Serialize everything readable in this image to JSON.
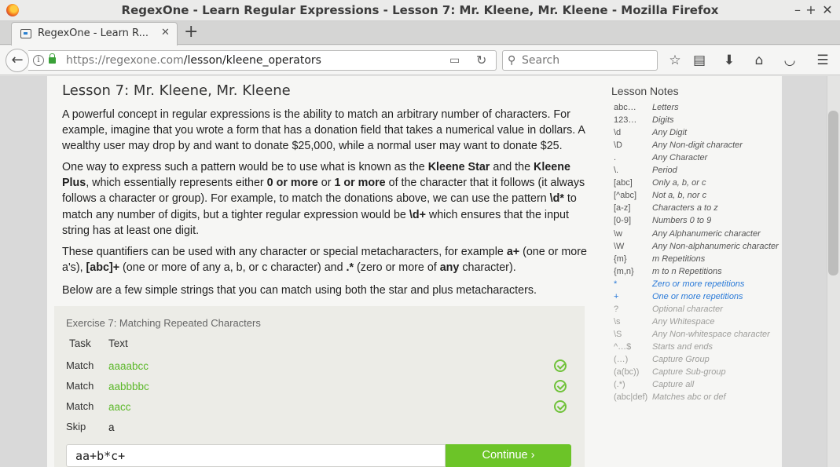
{
  "window": {
    "title": "RegexOne - Learn Regular Expressions - Lesson 7: Mr. Kleene, Mr. Kleene - Mozilla Firefox",
    "controls": {
      "minimize": "–",
      "maximize": "+",
      "close": "✕"
    }
  },
  "tab": {
    "title": "RegexOne - Learn R...",
    "close": "✕",
    "new_tab": "+"
  },
  "navbar": {
    "url_host": "https://regexone.com",
    "url_path": "/lesson/kleene_operators",
    "search_placeholder": "Search"
  },
  "lesson": {
    "title": "Lesson 7: Mr. Kleene, Mr. Kleene",
    "p1": "A powerful concept in regular expressions is the ability to match an arbitrary number of characters. For example, imagine that you wrote a form that has a donation field that takes a numerical value in dollars. A wealthy user may drop by and want to donate $25,000, while a normal user may want to donate $25.",
    "p2_a": "One way to express such a pattern would be to use what is known as the ",
    "p2_b": "Kleene Star",
    "p2_c": " and the ",
    "p2_d": "Kleene Plus",
    "p2_e": ", which essentially represents either ",
    "p2_f": "0 or more",
    "p2_g": " or ",
    "p2_h": "1 or more",
    "p2_i": " of the character that it follows (it always follows a character or group). For example, to match the donations above, we can use the pattern ",
    "p2_j": "\\d*",
    "p2_k": " to match any number of digits, but a tighter regular expression would be ",
    "p2_l": "\\d+",
    "p2_m": " which ensures that the input string has at least one digit.",
    "p3_a": "These quantifiers can be used with any character or special metacharacters, for example ",
    "p3_b": "a+",
    "p3_c": " (one or more a's), ",
    "p3_d": "[abc]+",
    "p3_e": " (one or more of any a, b, or c character) and ",
    "p3_f": ".*",
    "p3_g": " (zero or more of ",
    "p3_h": "any",
    "p3_i": " character).",
    "p4": "Below are a few simple strings that you can match using both the star and plus metacharacters."
  },
  "exercise": {
    "title": "Exercise 7: Matching Repeated Characters",
    "col_task": "Task",
    "col_text": "Text",
    "rows": [
      {
        "task": "Match",
        "text": "aaaabcc",
        "color": "#5cb82a"
      },
      {
        "task": "Match",
        "text": "aabbbbc",
        "color": "#5cb82a"
      },
      {
        "task": "Match",
        "text": "aacc",
        "color": "#5cb82a"
      },
      {
        "task": "Skip",
        "text": "a",
        "color": "#222222"
      }
    ],
    "answer": "aa+b*c+",
    "continue": "Continue ›"
  },
  "notes": {
    "title": "Lesson Notes",
    "items": [
      {
        "sym": "abc…",
        "desc": "Letters"
      },
      {
        "sym": "123…",
        "desc": "Digits"
      },
      {
        "sym": "\\d",
        "desc": "Any Digit"
      },
      {
        "sym": "\\D",
        "desc": "Any Non-digit character"
      },
      {
        "sym": ".",
        "desc": "Any Character"
      },
      {
        "sym": "\\.",
        "desc": "Period"
      },
      {
        "sym": "[abc]",
        "desc": "Only a, b, or c"
      },
      {
        "sym": "[^abc]",
        "desc": "Not a, b, nor c"
      },
      {
        "sym": "[a-z]",
        "desc": "Characters a to z"
      },
      {
        "sym": "[0-9]",
        "desc": "Numbers 0 to 9"
      },
      {
        "sym": "\\w",
        "desc": "Any Alphanumeric character"
      },
      {
        "sym": "\\W",
        "desc": "Any Non-alphanumeric character"
      },
      {
        "sym": "{m}",
        "desc": "m Repetitions"
      },
      {
        "sym": "{m,n}",
        "desc": "m to n Repetitions"
      },
      {
        "sym": "*",
        "desc": "Zero or more repetitions"
      },
      {
        "sym": "+",
        "desc": "One or more repetitions"
      },
      {
        "sym": "?",
        "desc": "Optional character"
      },
      {
        "sym": "\\s",
        "desc": "Any Whitespace"
      },
      {
        "sym": "\\S",
        "desc": "Any Non-whitespace character"
      },
      {
        "sym": "^…$",
        "desc": "Starts and ends"
      },
      {
        "sym": "(…)",
        "desc": "Capture Group"
      },
      {
        "sym": "(a(bc))",
        "desc": "Capture Sub-group"
      },
      {
        "sym": "(.*)",
        "desc": "Capture all"
      },
      {
        "sym": "(abc|def)",
        "desc": "Matches abc or def"
      }
    ],
    "active": [
      14,
      15
    ],
    "dim_from": 16
  }
}
